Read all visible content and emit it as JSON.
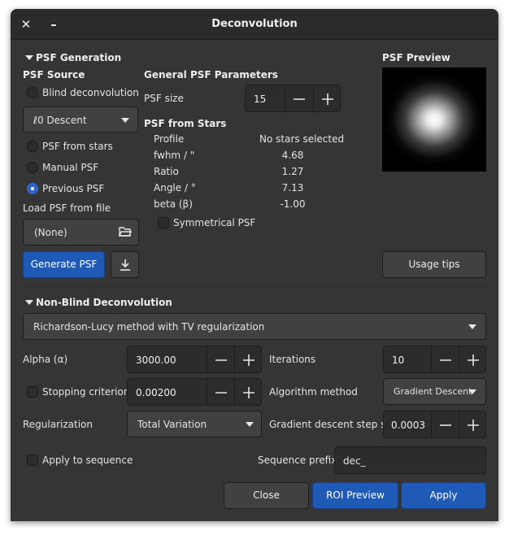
{
  "window": {
    "title": "Deconvolution"
  },
  "psf_generation": {
    "header": "PSF Generation",
    "psf_source_label": "PSF Source",
    "blind_label": "Blind deconvolution",
    "blind_method": "ℓ0 Descent",
    "from_stars_label": "PSF from stars",
    "manual_label": "Manual PSF",
    "previous_label": "Previous PSF",
    "selected_source": "Previous PSF",
    "load_label": "Load PSF from file",
    "file_value": "(None)",
    "generate_label": "Generate PSF"
  },
  "general_params": {
    "header": "General PSF Parameters",
    "psf_size_label": "PSF size",
    "psf_size": "15"
  },
  "psf_from_stars": {
    "header": "PSF from Stars",
    "rows": [
      {
        "label": "Profile",
        "value": "No stars selected"
      },
      {
        "label": "fwhm / \"",
        "value": "4.68"
      },
      {
        "label": "Ratio",
        "value": "1.27"
      },
      {
        "label": "Angle / °",
        "value": "7.13"
      },
      {
        "label": "beta (β)",
        "value": "-1.00"
      }
    ],
    "symmetrical_label": "Symmetrical PSF"
  },
  "psf_preview": {
    "header": "PSF Preview",
    "usage_label": "Usage tips"
  },
  "non_blind": {
    "header": "Non-Blind Deconvolution",
    "method": "Richardson-Lucy method with TV regularization",
    "alpha_label": "Alpha (α)",
    "alpha": "3000.00",
    "iterations_label": "Iterations",
    "iterations": "10",
    "stopping_label": "Stopping criterion",
    "stopping": "0.00200",
    "algorithm_label": "Algorithm method",
    "algorithm": "Gradient Descent",
    "regularization_label": "Regularization",
    "regularization": "Total Variation",
    "step_label": "Gradient descent step size",
    "step": "0.0003"
  },
  "sequence": {
    "apply_label": "Apply to sequence",
    "prefix_label": "Sequence prefix:",
    "prefix": "dec_"
  },
  "actions": {
    "close": "Close",
    "roi_preview": "ROI Preview",
    "apply": "Apply"
  },
  "colors": {
    "accent": "#1f5ab6",
    "window_bg": "#353535",
    "titlebar": "#2b2b2b"
  }
}
